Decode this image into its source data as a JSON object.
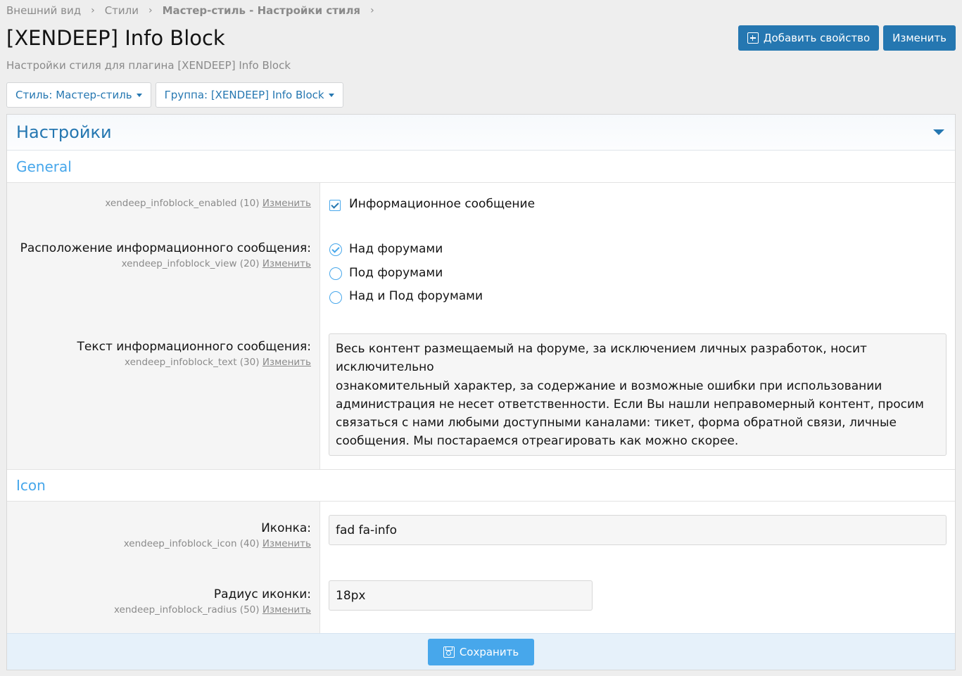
{
  "breadcrumb": [
    {
      "label": "Внешний вид"
    },
    {
      "label": "Стили"
    },
    {
      "label": "Мастер-стиль - Настройки стиля"
    }
  ],
  "page": {
    "title": "[XENDEEP] Info Block",
    "description": "Настройки стиля для плагина [XENDEEP] Info Block"
  },
  "toolbar": {
    "add_property_label": "Добавить свойство",
    "edit_label": "Изменить"
  },
  "filters": {
    "style_label": "Стиль: Мастер-стиль",
    "group_label": "Группа: [XENDEEP] Info Block"
  },
  "panel": {
    "title": "Настройки",
    "groups": {
      "general": "General",
      "icon": "Icon"
    },
    "edit_link": "Изменить"
  },
  "fields": {
    "enabled": {
      "key": "xendeep_infoblock_enabled (10)",
      "checkbox_label": "Информационное сообщение",
      "checked": true
    },
    "view": {
      "label": "Расположение информационного сообщения:",
      "key": "xendeep_infoblock_view (20)",
      "options": [
        "Над форумами",
        "Под форумами",
        "Над и Под форумами"
      ],
      "selected": "Над форумами"
    },
    "text": {
      "label": "Текст информационного сообщения:",
      "key": "xendeep_infoblock_text (30)",
      "lines": [
        "Весь контент размещаемый на форуме, за исключением личных разработок, носит исключительно",
        "ознакомительный характер, за содержание и возможные ошибки при использовании",
        "администрация не несет ответственности. Если Вы нашли неправомерный контент, просим",
        "связаться с нами любыми доступными каналами: тикет, форма обратной связи, личные",
        "сообщения. Мы постараемся отреагировать как можно скорее."
      ]
    },
    "icon": {
      "label": "Иконка:",
      "key": "xendeep_infoblock_icon (40)",
      "value": "fad fa-info"
    },
    "radius": {
      "label": "Радиус иконки:",
      "key": "xendeep_infoblock_radius (50)",
      "value": "18px"
    }
  },
  "footer": {
    "save_label": "Сохранить"
  },
  "colors": {
    "primary": "#2577b1",
    "accent": "#47a7eb",
    "background": "#eeeeee"
  }
}
